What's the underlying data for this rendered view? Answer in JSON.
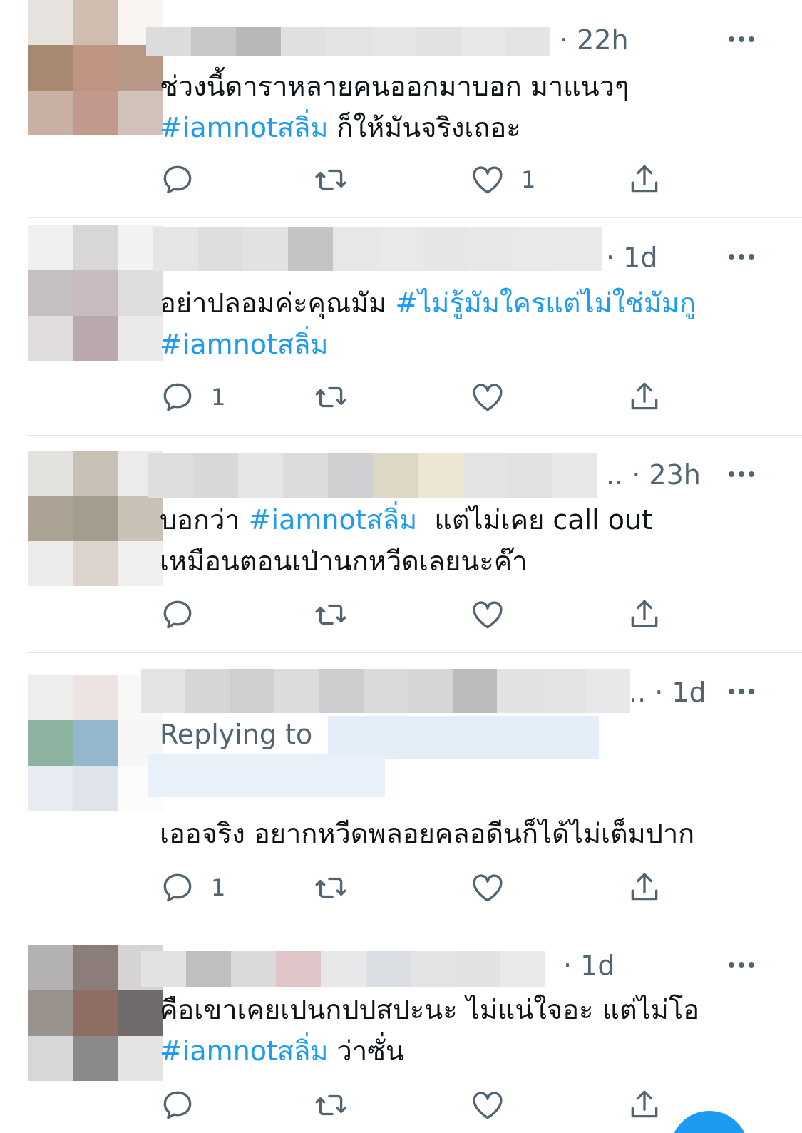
{
  "tweets": [
    {
      "time": "· 22h",
      "body": [
        {
          "text": "ช่วงนี้ดาราหลายคนออกมาบอก มาแนวๆ\n",
          "tag": false
        },
        {
          "text": "#iamnotสลิ่ม",
          "tag": true
        },
        {
          "text": " ก็ให้มันจริงเถอะ",
          "tag": false
        }
      ],
      "counts": {
        "reply": "",
        "retweet": "",
        "like": "1"
      }
    },
    {
      "time": "· 1d",
      "body": [
        {
          "text": "อย่าปลอมค่ะคุณมัม ",
          "tag": false
        },
        {
          "text": "#ไม่รู้มัมใครแต่ไม่ใช่มัมกู",
          "tag": true
        },
        {
          "text": "\n",
          "tag": false
        },
        {
          "text": "#iamnotสลิ่ม",
          "tag": true
        }
      ],
      "counts": {
        "reply": "1",
        "retweet": "",
        "like": ""
      }
    },
    {
      "time": ".. · 23h",
      "body": [
        {
          "text": "บอกว่า ",
          "tag": false
        },
        {
          "text": "#iamnotสลิ่ม",
          "tag": true
        },
        {
          "text": "  แต่ไม่เคย call out\nเหมือนตอนเป่านกหวีดเลยนะค๊า",
          "tag": false
        }
      ],
      "counts": {
        "reply": "",
        "retweet": "",
        "like": ""
      }
    },
    {
      "time": ".. · 1d",
      "replying_to": "Replying to",
      "body": [
        {
          "text": "เออจริง อยากหวีดพลอยคลอดีนก็ได้ไม่เต็มปาก",
          "tag": false
        }
      ],
      "counts": {
        "reply": "1",
        "retweet": "",
        "like": ""
      }
    },
    {
      "time": "· 1d",
      "body": [
        {
          "text": "คือเขาเคยเปนกปปสปะนะ ไม่แน่ใจอะ แต่ไม่โอ\n",
          "tag": false
        },
        {
          "text": "#iamnotสลิ่ม",
          "tag": true
        },
        {
          "text": " ว่าซั่น",
          "tag": false
        }
      ],
      "counts": {
        "reply": "",
        "retweet": "",
        "like": ""
      }
    }
  ],
  "icons": {
    "reply": "reply-icon",
    "retweet": "retweet-icon",
    "like": "heart-icon",
    "share": "share-icon",
    "more": "more-icon"
  },
  "colors": {
    "hashtag": "#1d9bf0",
    "secondary_text": "#536471",
    "divider": "#e1e8ed"
  }
}
